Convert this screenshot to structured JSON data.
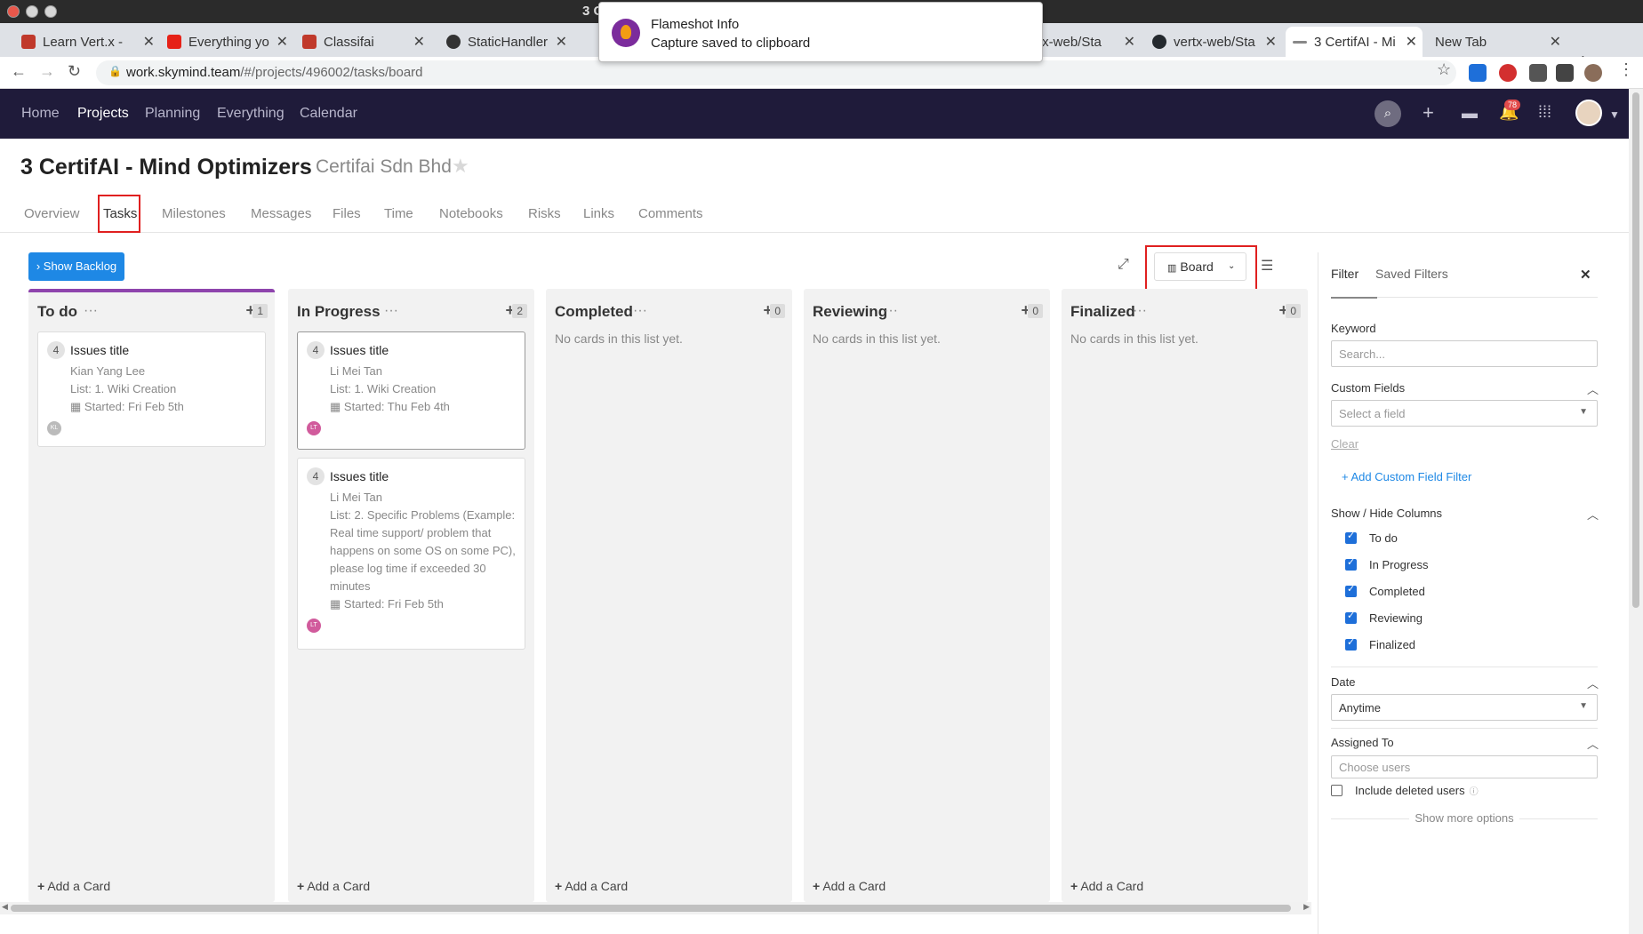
{
  "window": {
    "title": "3 C                                                                                                                                                                                            um"
  },
  "browser": {
    "tabs": [
      {
        "label": "Learn Vert.x -",
        "color": "#c0392b"
      },
      {
        "label": "Everything yo",
        "color": "#e62117"
      },
      {
        "label": "Classifai",
        "color": "#c0392b"
      },
      {
        "label": "StaticHandler",
        "color": "#333333"
      },
      {
        "label": "rtx-web/Sta",
        "color": "#555555"
      },
      {
        "label": "vertx-web/Sta",
        "color": "#24292e"
      },
      {
        "label": "3 CertifAI - Mi",
        "color": "#888888"
      },
      {
        "label": "New Tab",
        "color": "#dee1e6"
      }
    ],
    "url_host": "work.skymind.team",
    "url_path": "/#/projects/496002/tasks/board"
  },
  "notification": {
    "title": "Flameshot Info",
    "message": "Capture saved to clipboard"
  },
  "appnav": {
    "items": [
      "Home",
      "Projects",
      "Planning",
      "Everything",
      "Calendar"
    ],
    "active": "Projects",
    "notification_count": "78"
  },
  "project": {
    "title": "3 CertifAI - Mind Optimizers",
    "company": "Certifai Sdn Bhd",
    "tabs": [
      "Overview",
      "Tasks",
      "Milestones",
      "Messages",
      "Files",
      "Time",
      "Notebooks",
      "Risks",
      "Links",
      "Comments"
    ],
    "active_tab": "Tasks"
  },
  "toolbar": {
    "backlog_label": "› Show Backlog",
    "view_label": "Board"
  },
  "board": {
    "empty_text": "No cards in this list yet.",
    "add_card_label": "Add a Card",
    "columns": [
      {
        "name": "To do",
        "count": "1",
        "cards": [
          {
            "num": "4",
            "title": "Issues title",
            "assignee": "Kian Yang Lee",
            "list": "List: 1. Wiki Creation",
            "started": "Started: Fri Feb 5th",
            "initials": "KL"
          }
        ]
      },
      {
        "name": "In Progress",
        "count": "2",
        "cards": [
          {
            "num": "4",
            "title": "Issues title",
            "assignee": "Li Mei Tan",
            "list": "List: 1. Wiki Creation",
            "started": "Started: Thu Feb 4th",
            "initials": "LT"
          },
          {
            "num": "4",
            "title": "Issues title",
            "assignee": "Li Mei Tan",
            "list": "List: 2. Specific Problems (Example: Real time support/ problem that happens on some OS on some PC), please log time if exceeded 30 minutes",
            "started": "Started: Fri Feb 5th",
            "initials": "LT"
          }
        ]
      },
      {
        "name": "Completed",
        "count": "0",
        "cards": []
      },
      {
        "name": "Reviewing",
        "count": "0",
        "cards": []
      },
      {
        "name": "Finalized",
        "count": "0",
        "cards": []
      }
    ]
  },
  "filter": {
    "tab_filter": "Filter",
    "tab_saved": "Saved Filters",
    "keyword_label": "Keyword",
    "keyword_placeholder": "Search...",
    "custom_fields_label": "Custom Fields",
    "custom_field_placeholder": "Select a field",
    "clear_label": "Clear",
    "add_custom_label": "Add Custom Field Filter",
    "columns_label": "Show / Hide Columns",
    "columns": [
      "To do",
      "In Progress",
      "Completed",
      "Reviewing",
      "Finalized"
    ],
    "date_label": "Date",
    "date_value": "Anytime",
    "assigned_label": "Assigned To",
    "assigned_placeholder": "Choose users",
    "include_deleted_label": "Include deleted users",
    "show_more_label": "Show more options"
  }
}
